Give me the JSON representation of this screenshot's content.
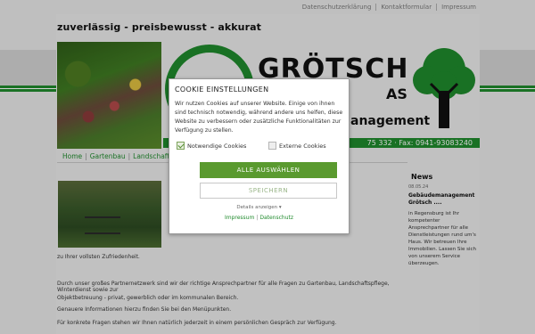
{
  "top_links": [
    "Datenschutzerklärung",
    "Kontaktformular",
    "Impressum"
  ],
  "tagline": "zuverlässig - preisbewusst - akkurat",
  "logo": {
    "name": "GRÖTSCH",
    "sub": "AS",
    "mgmt": "anagement"
  },
  "contact_bar": "75 332 · Fax: 0941-93083240",
  "breadcrumb": [
    "Home",
    "Gartenbau",
    "Landschaftspf"
  ],
  "body": {
    "line1": "zu Ihrer vollsten Zufriedenheit.",
    "line2": "Durch unser großes Partnernetzwerk sind wir der richtige Ansprechpartner für alle Fragen zu Gartenbau, Landschaftspflege, Winterdienst sowie zur",
    "line3": "Objektbetreuung - privat, gewerblich oder im kommunalen Bereich.",
    "line4": "Genauere Informationen hierzu finden Sie bei den Menüpunkten.",
    "line5": "Für konkrete Fragen stehen wir Ihnen natürlich jederzeit in einem persönlichen Gespräch zur Verfügung."
  },
  "news": {
    "title": "News",
    "date": "08.05.24",
    "headline": "Gebäudemanagement Grötsch ....",
    "text": "in Regensburg ist Ihr kompetenter Ansprechpartner für alle Dienstleistungen rund um's Haus. Wir betreuen Ihre Immobilien. Lassen Sie sich von unserem Service überzeugen."
  },
  "cookie": {
    "title": "COOKIE EINSTELLUNGEN",
    "text": "Wir nutzen Cookies auf unserer Website. Einige von ihnen sind technisch notwendig, während andere uns helfen, diese Website zu verbessern oder zusätzliche Funktionalitäten zur Verfügung zu stellen.",
    "necessary_label": "Notwendige Cookies",
    "external_label": "Externe Cookies",
    "accept_all": "ALLE AUSWÄHLEN",
    "save": "SPEICHERN",
    "details": "Details anzeigen ▾",
    "imprint": "Impressum",
    "privacy": "Datenschutz"
  },
  "colors": {
    "green": "#1f8a2c",
    "button_green": "#5a9a2f"
  }
}
